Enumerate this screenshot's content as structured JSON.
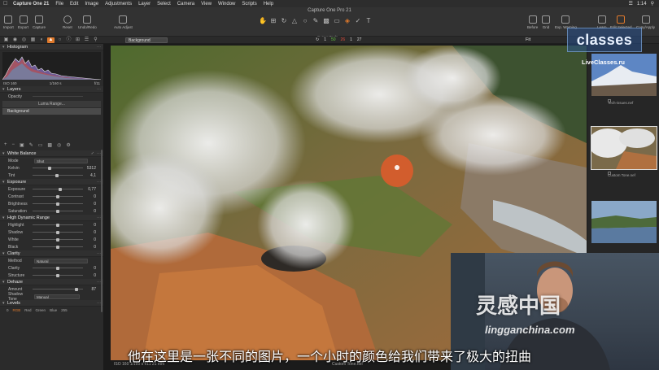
{
  "menubar": {
    "app": "Capture One 21",
    "items": [
      "File",
      "Edit",
      "Image",
      "Adjustments",
      "Layer",
      "Select",
      "Camera",
      "View",
      "Window",
      "Scripts",
      "Help"
    ],
    "clock": "1:14"
  },
  "window_title": "Capture One Pro 21",
  "toolbar": {
    "left": [
      "Import",
      "Export",
      "Capture",
      "Reset",
      "Undo/Redo",
      "Auto Adjust"
    ],
    "right": [
      "Before",
      "Grid",
      "Exp. Warning",
      "Learn",
      "Edit Selected",
      "Copy/Apply"
    ],
    "cursor_tools_label": "Cursor Tools"
  },
  "row2": {
    "layer_select": "Background",
    "info_left": "1",
    "info_g": "50",
    "info_r": "26",
    "info_a": "1",
    "info_b": "27",
    "fit": "Fit"
  },
  "histogram": {
    "title": "Histogram",
    "iso": "ISO 160",
    "shutter": "1/160 s",
    "aperture": "f/11"
  },
  "layers": {
    "title": "Layers",
    "opacity_label": "Opacity",
    "luma_button": "Luma Range...",
    "background_item": "Background"
  },
  "white_balance": {
    "title": "White Balance",
    "mode_label": "Mode",
    "mode_value": "Shot",
    "kelvin_label": "Kelvin",
    "kelvin_value": "5312",
    "tint_label": "Tint",
    "tint_value": "4,1"
  },
  "exposure": {
    "title": "Exposure",
    "rows": [
      {
        "label": "Exposure",
        "value": "0,77",
        "pos": 0.55
      },
      {
        "label": "Contrast",
        "value": "0",
        "pos": 0.5
      },
      {
        "label": "Brightness",
        "value": "0",
        "pos": 0.5
      },
      {
        "label": "Saturation",
        "value": "0",
        "pos": 0.5
      }
    ]
  },
  "hdr": {
    "title": "High Dynamic Range",
    "rows": [
      {
        "label": "Highlight",
        "value": "0",
        "pos": 0.5
      },
      {
        "label": "Shadow",
        "value": "0",
        "pos": 0.5
      },
      {
        "label": "White",
        "value": "0",
        "pos": 0.5
      },
      {
        "label": "Black",
        "value": "0",
        "pos": 0.5
      }
    ]
  },
  "clarity": {
    "title": "Clarity",
    "method_label": "Method",
    "method_value": "Natural",
    "rows": [
      {
        "label": "Clarity",
        "value": "0",
        "pos": 0.5
      },
      {
        "label": "Structure",
        "value": "0",
        "pos": 0.5
      }
    ]
  },
  "dehaze": {
    "title": "Dehaze",
    "amount_label": "Amount",
    "amount_value": "87",
    "amount_pos": 0.87,
    "shadow_tone_label": "Shadow Tone",
    "shadow_tone_value": "Manual"
  },
  "levels": {
    "title": "Levels",
    "tabs": [
      "0",
      "RGB",
      "Red",
      "Green",
      "Blue",
      "255"
    ]
  },
  "viewer": {
    "footer_left": "ISO 160    1/160 s    f/11    21 mm",
    "footer_center": "Custom Tone.nef"
  },
  "browser": {
    "items": [
      {
        "name": "Tech-issues.nef"
      },
      {
        "name": "Custom Tone.nef"
      },
      {
        "name": ""
      }
    ]
  },
  "watermark": {
    "badge": "classes",
    "url": "LiveClasses.ru",
    "cn_main": "灵感中国",
    "cn_sub": "lingganchina.com"
  },
  "subtitle": "他在这里是一张不同的图片，一个小时的颜色给我们带来了极大的扭曲"
}
